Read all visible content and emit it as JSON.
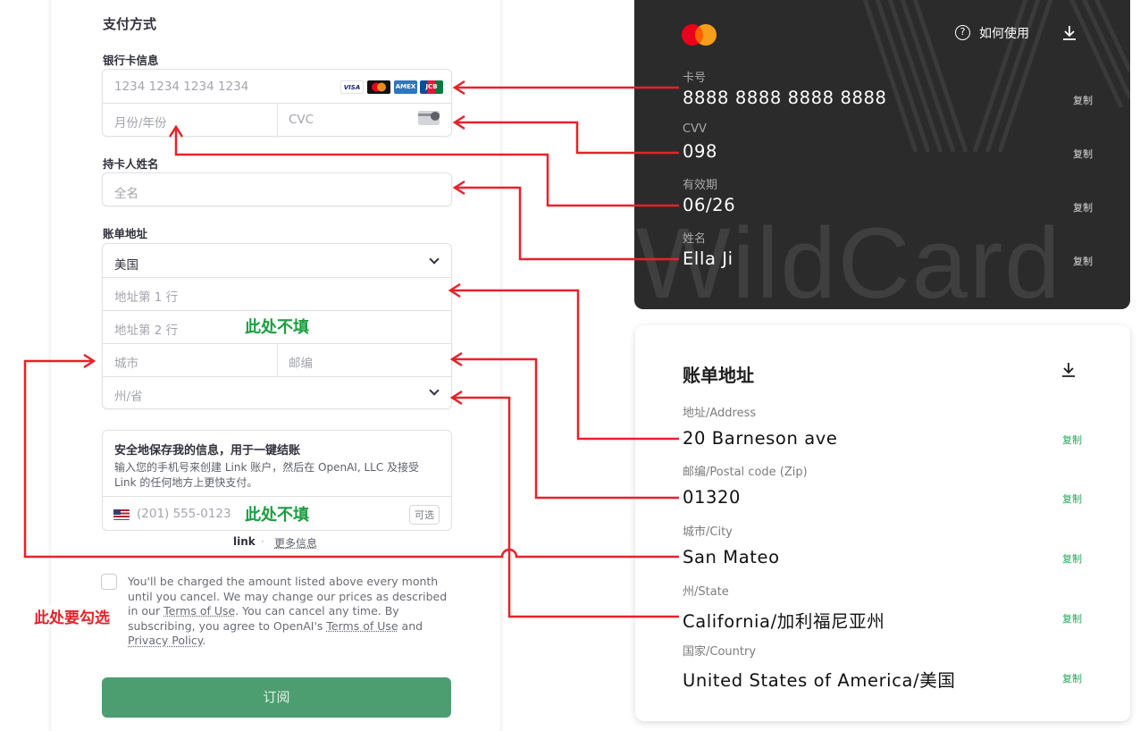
{
  "form": {
    "section_title": "支付方式",
    "card_info_label": "银行卡信息",
    "card_number_placeholder": "1234 1234 1234 1234",
    "card_brands": [
      "VISA",
      "MC",
      "AMEX",
      "JCB"
    ],
    "expiry_placeholder": "月份/年份",
    "cvc_placeholder": "CVC",
    "cardholder_label": "持卡人姓名",
    "fullname_placeholder": "全名",
    "billing_label": "账单地址",
    "country_value": "美国",
    "address1_placeholder": "地址第 1 行",
    "address2_placeholder": "地址第 2 行",
    "city_placeholder": "城市",
    "zip_placeholder": "邮编",
    "state_placeholder": "州/省",
    "link_title": "安全地保存我的信息，用于一键结账",
    "link_desc": "输入您的手机号来创建 Link 账户，然后在 OpenAI, LLC 及接受 Link 的任何地方上更快支付。",
    "phone_placeholder": "(201) 555-0123",
    "optional_label": "可选",
    "link_brand": "link",
    "link_sep": "·",
    "more_info": "更多信息",
    "terms_part1": "You'll be charged the amount listed above every month until you cancel. We may change our prices as described in our ",
    "terms_link1": "Terms of Use",
    "terms_part2": ". You can cancel any time. By subscribing, you agree to OpenAI's ",
    "terms_link2": "Terms of Use",
    "terms_part3": " and ",
    "terms_link3": "Privacy Policy",
    "terms_part4": ".",
    "subscribe_label": "订阅"
  },
  "notes": {
    "no_fill_1": "此处不填",
    "no_fill_2": "此处不填",
    "must_check": "此处要勾选"
  },
  "card": {
    "how_to_use": "如何使用",
    "help_glyph": "?",
    "watermark": "WildCard",
    "fields": [
      {
        "label": "卡号",
        "value": "8888 8888 8888 8888",
        "copy": "复制"
      },
      {
        "label": "CVV",
        "value": "098",
        "copy": "复制"
      },
      {
        "label": "有效期",
        "value": "06/26",
        "copy": "复制"
      },
      {
        "label": "姓名",
        "value": "Ella Ji",
        "copy": "复制"
      }
    ]
  },
  "address": {
    "title": "账单地址",
    "fields": [
      {
        "label": "地址/Address",
        "value": "20 Barneson ave",
        "copy": "复制"
      },
      {
        "label": "邮编/Postal code (Zip)",
        "value": "01320",
        "copy": "复制"
      },
      {
        "label": "城市/City",
        "value": "San Mateo",
        "copy": "复制"
      },
      {
        "label": "州/State",
        "value": "California/加利福尼亚州",
        "copy": "复制"
      },
      {
        "label": "国家/Country",
        "value": "United States of America/美国",
        "copy": "复制"
      }
    ]
  },
  "colors": {
    "arrow": "#e8212a",
    "accent_green": "#4c9e70",
    "note_green": "#1a9e3f",
    "copy_green": "#23a559",
    "card_bg": "#2b2b2b"
  }
}
